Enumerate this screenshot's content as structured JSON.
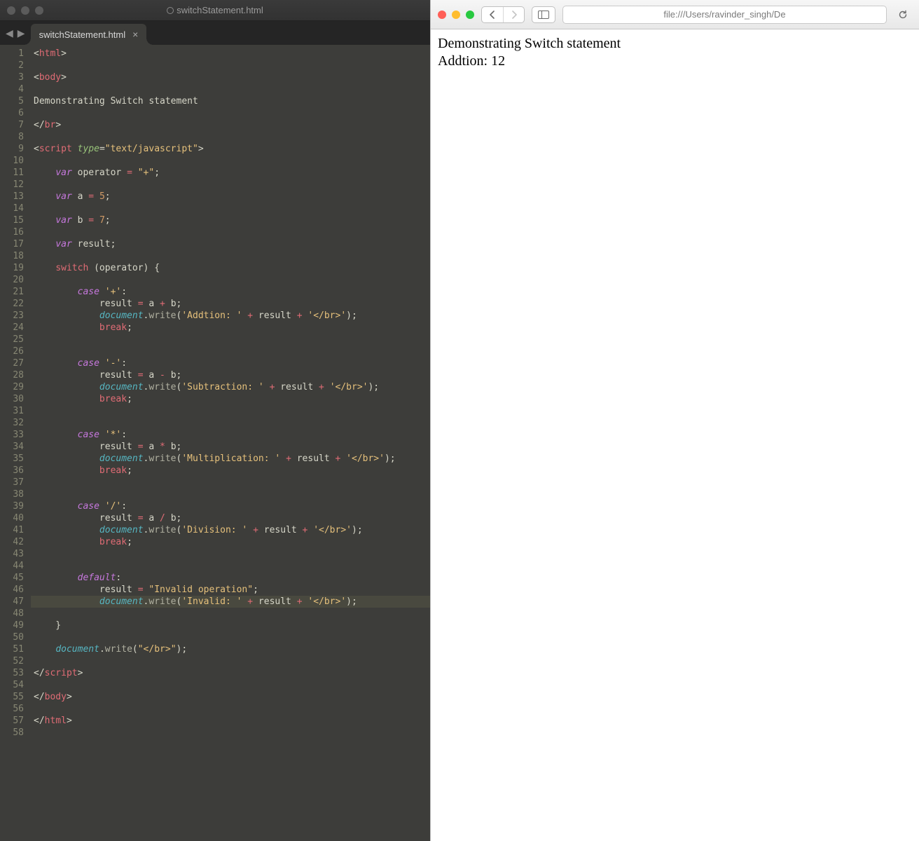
{
  "editor": {
    "titlebar_filename": "switchStatement.html",
    "traffic_gray": "#5b5b5b",
    "tab": {
      "label": "switchStatement.html"
    },
    "highlighted_line": 47,
    "line_count": 58,
    "code": {
      "l1": {
        "a": "<",
        "b": "html",
        "c": ">"
      },
      "l3": {
        "a": "<",
        "b": "body",
        "c": ">"
      },
      "l5": "Demonstrating Switch statement",
      "l7": {
        "a": "</",
        "b": "br",
        "c": ">"
      },
      "l9": {
        "a": "<",
        "b": "script",
        "sp": " ",
        "attr": "type",
        "eq": "=",
        "val": "\"text/javascript\"",
        "c": ">"
      },
      "l11": {
        "kw": "var",
        "sp": " ",
        "nm": "operator",
        "sp2": " ",
        "op": "=",
        "sp3": " ",
        "str": "\"+\"",
        "semi": ";"
      },
      "l13": {
        "kw": "var",
        "sp": " ",
        "nm": "a",
        "sp2": " ",
        "op": "=",
        "sp3": " ",
        "num": "5",
        "semi": ";"
      },
      "l15": {
        "kw": "var",
        "sp": " ",
        "nm": "b",
        "sp2": " ",
        "op": "=",
        "sp3": " ",
        "num": "7",
        "semi": ";"
      },
      "l17": {
        "kw": "var",
        "sp": " ",
        "nm": "result",
        "semi": ";"
      },
      "l19": {
        "kw": "switch",
        "sp": " ",
        "paren": "(operator) {"
      },
      "l21": {
        "kw": "case",
        "sp": " ",
        "str": "'+'",
        "colon": ":"
      },
      "l22": {
        "nm": "result",
        "sp": " ",
        "op": "=",
        "sp2": " ",
        "a": "a",
        "sp3": " ",
        "op2": "+",
        "sp4": " ",
        "b": "b",
        "semi": ";"
      },
      "l23": {
        "doc": "document",
        "dot": ".",
        "fn": "write",
        "open": "(",
        "s1": "'Addtion: '",
        "sp": " ",
        "op": "+",
        "sp2": " ",
        "r": "result",
        "sp3": " ",
        "op2": "+",
        "sp4": " ",
        "s2": "'</br>'",
        "close": ");"
      },
      "l24": {
        "kw": "break",
        "semi": ";"
      },
      "l27": {
        "kw": "case",
        "sp": " ",
        "str": "'-'",
        "colon": ":"
      },
      "l28": {
        "nm": "result",
        "sp": " ",
        "op": "=",
        "sp2": " ",
        "a": "a",
        "sp3": " ",
        "op2": "-",
        "sp4": " ",
        "b": "b",
        "semi": ";"
      },
      "l29": {
        "doc": "document",
        "dot": ".",
        "fn": "write",
        "open": "(",
        "s1": "'Subtraction: '",
        "sp": " ",
        "op": "+",
        "sp2": " ",
        "r": "result",
        "sp3": " ",
        "op2": "+",
        "sp4": " ",
        "s2": "'</br>'",
        "close": ");"
      },
      "l30": {
        "kw": "break",
        "semi": ";"
      },
      "l33": {
        "kw": "case",
        "sp": " ",
        "str": "'*'",
        "colon": ":"
      },
      "l34": {
        "nm": "result",
        "sp": " ",
        "op": "=",
        "sp2": " ",
        "a": "a",
        "sp3": " ",
        "op2": "*",
        "sp4": " ",
        "b": "b",
        "semi": ";"
      },
      "l35": {
        "doc": "document",
        "dot": ".",
        "fn": "write",
        "open": "(",
        "s1": "'Multiplication: '",
        "sp": " ",
        "op": "+",
        "sp2": " ",
        "r": "result",
        "sp3": " ",
        "op2": "+",
        "sp4": " ",
        "s2": "'</br>'",
        "close": ");"
      },
      "l36": {
        "kw": "break",
        "semi": ";"
      },
      "l39": {
        "kw": "case",
        "sp": " ",
        "str": "'/'",
        "colon": ":"
      },
      "l40": {
        "nm": "result",
        "sp": " ",
        "op": "=",
        "sp2": " ",
        "a": "a",
        "sp3": " ",
        "op2": "/",
        "sp4": " ",
        "b": "b",
        "semi": ";"
      },
      "l41": {
        "doc": "document",
        "dot": ".",
        "fn": "write",
        "open": "(",
        "s1": "'Division: '",
        "sp": " ",
        "op": "+",
        "sp2": " ",
        "r": "result",
        "sp3": " ",
        "op2": "+",
        "sp4": " ",
        "s2": "'</br>'",
        "close": ");"
      },
      "l42": {
        "kw": "break",
        "semi": ";"
      },
      "l45": {
        "kw": "default",
        "colon": ":"
      },
      "l46": {
        "nm": "result",
        "sp": " ",
        "op": "=",
        "sp2": " ",
        "str": "\"Invalid operation\"",
        "semi": ";"
      },
      "l47": {
        "doc": "document",
        "dot": ".",
        "fn": "write",
        "open": "(",
        "s1": "'Invalid: '",
        "sp": " ",
        "op": "+",
        "sp2": " ",
        "r": "result",
        "sp3": " ",
        "op2": "+",
        "sp4": " ",
        "s2": "'</br>'",
        "close": ");"
      },
      "l49": "    }",
      "l51": {
        "doc": "document",
        "dot": ".",
        "fn": "write",
        "open": "(",
        "s1": "\"</br>\"",
        "close": ");"
      },
      "l53": {
        "a": "</",
        "b": "script",
        "c": ">"
      },
      "l55": {
        "a": "</",
        "b": "body",
        "c": ">"
      },
      "l57": {
        "a": "</",
        "b": "html",
        "c": ">"
      }
    }
  },
  "browser": {
    "url": "file:///Users/ravinder_singh/De",
    "output_line1": "Demonstrating Switch statement",
    "output_line2": "Addtion: 12"
  }
}
